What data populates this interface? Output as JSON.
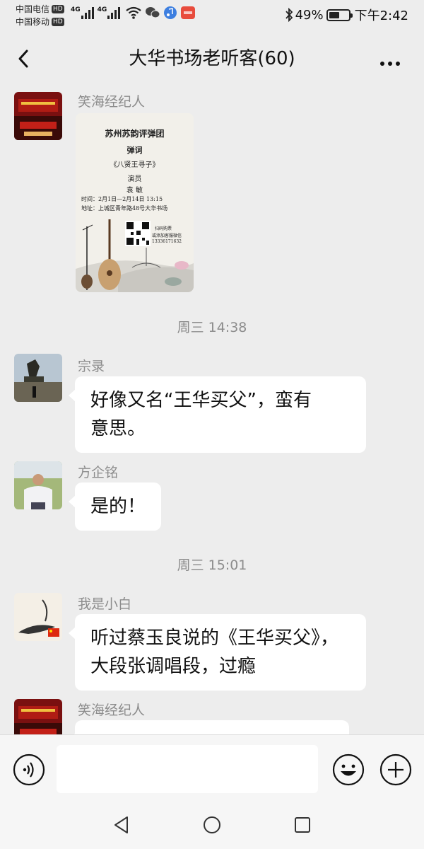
{
  "status_bar": {
    "carrier1": "中国电信",
    "carrier2": "中国移动",
    "hd": "HD",
    "network": "4G",
    "battery_text": "49%",
    "battery_level": 0.49,
    "time": "下午2:42"
  },
  "header": {
    "title": "大华书场老听客(60)"
  },
  "messages": [
    {
      "sender": "笑海经纪人",
      "type": "image",
      "poster": {
        "line1": "苏州苏韵评弹团",
        "line2": "弹词",
        "line3": "《八贤王寻子》",
        "line4": "演员",
        "line5": "袁 敏",
        "time_line": "时间：2月1日—2月14日 13:15",
        "addr_line": "地址：上城区青年路48号大华书场",
        "qr_line1": "扫码购票",
        "qr_line2": "或添加客服微信",
        "phone": "13336171632"
      }
    },
    {
      "type": "timestamp",
      "text": "周三 14:38"
    },
    {
      "sender": "宗录",
      "type": "text",
      "lines": [
        "好像又名“王华买父”，蛮有",
        "意思。"
      ]
    },
    {
      "sender": "方企铭",
      "type": "text",
      "lines": [
        "是的！"
      ]
    },
    {
      "type": "timestamp",
      "text": "周三 15:01"
    },
    {
      "sender": "我是小白",
      "type": "text",
      "lines": [
        "听过蔡玉良说的《王华买父》，",
        "大段张调唱段，过瘾"
      ]
    },
    {
      "sender": "笑海经纪人",
      "type": "text",
      "lines": []
    }
  ],
  "colors": {
    "background": "#ededed",
    "bubble": "#ffffff",
    "meta_text": "#8c8c8c"
  }
}
